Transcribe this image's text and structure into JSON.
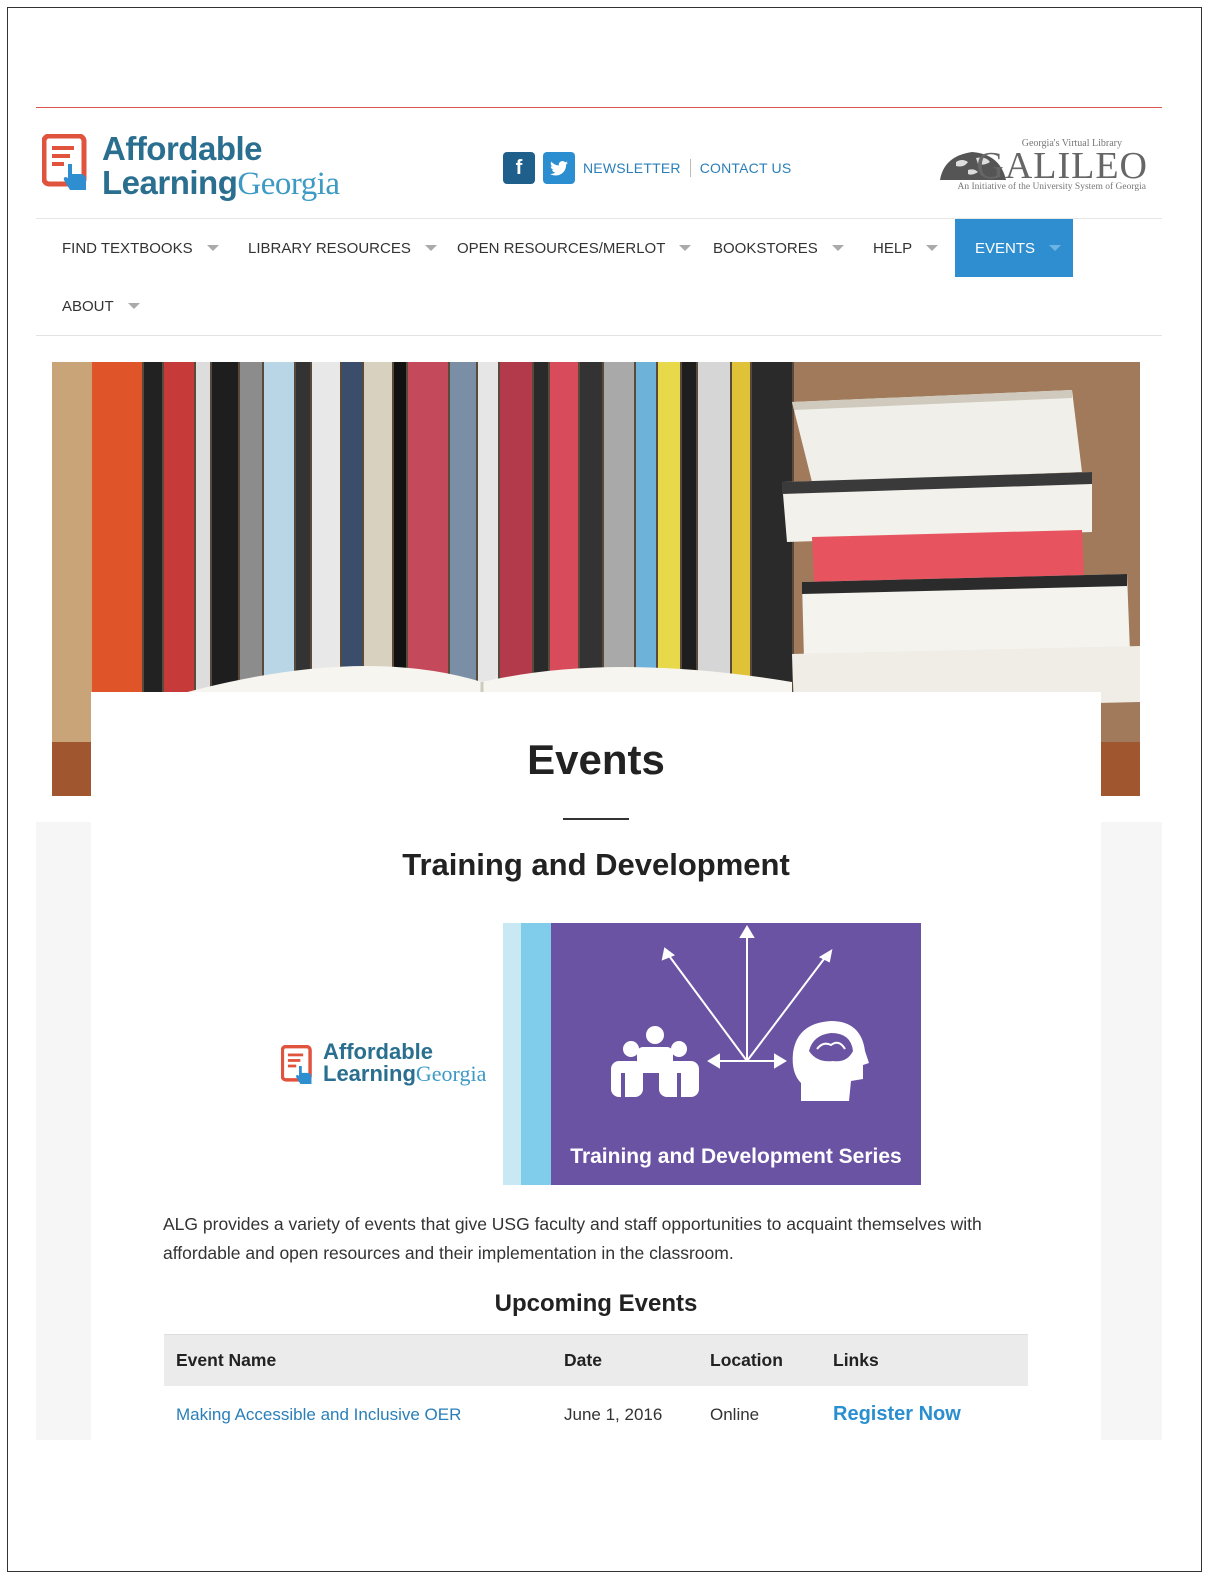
{
  "brand": {
    "line1": "Affordable",
    "line2a": "Learning",
    "line2b": "Georgia"
  },
  "social": {
    "facebook_glyph": "f",
    "twitter_icon": "twitter-icon",
    "newsletter": "NEWSLETTER",
    "contact": "CONTACT US"
  },
  "galileo": {
    "tagline": "Georgia's Virtual Library",
    "name": "GALILEO",
    "subline": "An Initiative of the University System of Georgia"
  },
  "nav": {
    "items": [
      {
        "label": "FIND TEXTBOOKS"
      },
      {
        "label": "LIBRARY RESOURCES"
      },
      {
        "label": "OPEN RESOURCES/MERLOT"
      },
      {
        "label": "BOOKSTORES"
      },
      {
        "label": "HELP"
      },
      {
        "label": "EVENTS",
        "active": true
      },
      {
        "label": "ABOUT"
      }
    ]
  },
  "page": {
    "title": "Events",
    "section_title": "Training and Development",
    "promo_caption": "Training and Development Series",
    "intro": "ALG provides a variety of events that give USG faculty and staff opportunities to acquaint themselves with affordable and open resources and their implementation in the classroom.",
    "upcoming_title": "Upcoming Events"
  },
  "table": {
    "headers": [
      "Event Name",
      "Date",
      "Location",
      "Links"
    ],
    "rows": [
      {
        "name": "Making Accessible and Inclusive OER",
        "date": "June 1, 2016",
        "location": "Online",
        "link": "Register Now"
      }
    ]
  },
  "colors": {
    "accent": "#2f8ed0",
    "brand_dark": "#2a6f8f",
    "promo_purple": "#6b53a3",
    "rule_red": "#d9534f"
  }
}
